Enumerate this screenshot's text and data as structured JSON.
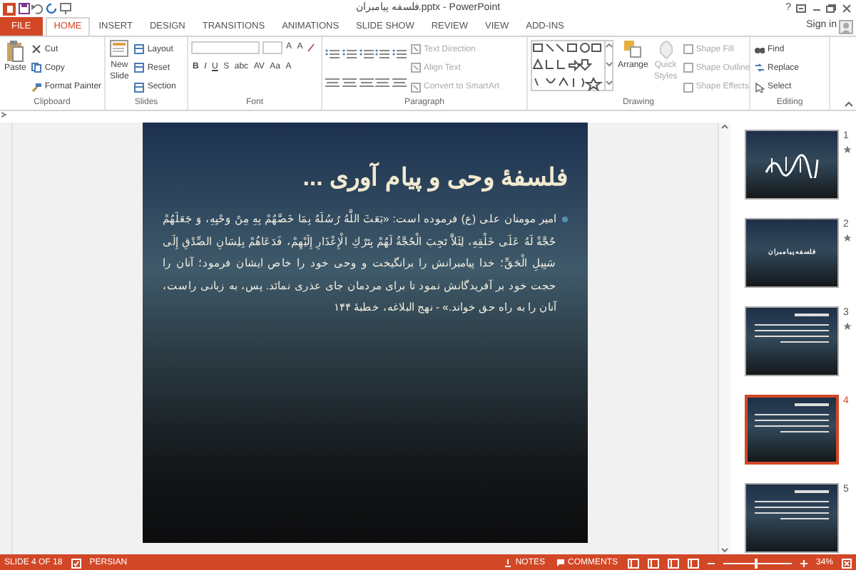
{
  "window": {
    "title": "فلسفه پیامبران.pptx - PowerPoint",
    "sign_in": "Sign in",
    "help": "?"
  },
  "tabs": [
    {
      "label": "FILE",
      "kind": "file",
      "selected": false
    },
    {
      "label": "HOME",
      "kind": "tab",
      "selected": true
    },
    {
      "label": "INSERT",
      "kind": "tab",
      "selected": false
    },
    {
      "label": "DESIGN",
      "kind": "tab",
      "selected": false
    },
    {
      "label": "TRANSITIONS",
      "kind": "tab",
      "selected": false
    },
    {
      "label": "ANIMATIONS",
      "kind": "tab",
      "selected": false
    },
    {
      "label": "SLIDE SHOW",
      "kind": "tab",
      "selected": false
    },
    {
      "label": "REVIEW",
      "kind": "tab",
      "selected": false
    },
    {
      "label": "VIEW",
      "kind": "tab",
      "selected": false
    },
    {
      "label": "ADD-INS",
      "kind": "tab",
      "selected": false
    }
  ],
  "ribbon": {
    "clipboard": {
      "label": "Clipboard",
      "paste": "Paste",
      "items": [
        {
          "label": "Cut",
          "disabled": false
        },
        {
          "label": "Copy",
          "disabled": false
        },
        {
          "label": "Format Painter",
          "disabled": false
        }
      ]
    },
    "slides": {
      "label": "Slides",
      "new_slide": [
        "New",
        "Slide"
      ],
      "items": [
        {
          "label": "Layout",
          "disabled": false
        },
        {
          "label": "Reset",
          "disabled": false
        },
        {
          "label": "Section",
          "disabled": false
        }
      ]
    },
    "font": {
      "label": "Font",
      "grow": [
        "A",
        "A"
      ],
      "format_buttons": [
        "B",
        "I",
        "U",
        "S",
        "abc",
        "AV",
        "Aa",
        "A"
      ]
    },
    "paragraph": {
      "label": "Paragraph",
      "items": [
        {
          "label": "Text Direction",
          "disabled": true
        },
        {
          "label": "Align Text",
          "disabled": true
        },
        {
          "label": "Convert to SmartArt",
          "disabled": true
        }
      ]
    },
    "drawing": {
      "label": "Drawing",
      "arrange": "Arrange",
      "quick_styles": {
        "label": [
          "Quick",
          "Styles"
        ],
        "disabled": true
      },
      "items": [
        {
          "label": "Shape Fill",
          "disabled": true
        },
        {
          "label": "Shape Outline",
          "disabled": true
        },
        {
          "label": "Shape Effects",
          "disabled": true
        }
      ]
    },
    "editing": {
      "label": "Editing",
      "items": [
        {
          "label": "Find",
          "disabled": false
        },
        {
          "label": "Replace",
          "disabled": false
        },
        {
          "label": "Select",
          "disabled": false
        }
      ]
    }
  },
  "slide": {
    "title": "فلسفۀ وحی و پیام آوری ...",
    "body": "امیر مومنان علی (ع) فرموده است: «بَعَثَ اللَّهُ رُسُلَهُ بِمَا خَصَّهُمْ بِهِ مِنْ وَحْيِهِ، وَ جَعَلَهُمْ حُجَّةً لَهُ عَلَى خَلْقِهِ، لِئَلاَّ تَجِبَ الْحُجَّةُ لَهُمْ بِتَرْكِ الْإِعْذَارِ إِلَيْهِمْ، فَدَعَاهُمْ بِلِسَانِ الصِّدْقِ إِلَى سَبِيلِ الْحَقِّ؛ خدا پیامبرانش را برانگیخت و وحی خود را خاص ایشان فرمود؛ آنان را حجت خود بر آفریدگانش نمود تا برای مردمان جای عذری نمانَد. پس، به زبانی راست، آنان را به راه حق خواند.» - نهج البلاغه، خطبۀ ۱۴۴"
  },
  "thumbnails": [
    {
      "number": "1",
      "starred": true,
      "selected": false,
      "kind": "calligraphy"
    },
    {
      "number": "2",
      "starred": true,
      "selected": false,
      "kind": "cover",
      "title": "فلسفه پیامبران"
    },
    {
      "number": "3",
      "starred": true,
      "selected": false,
      "kind": "text"
    },
    {
      "number": "4",
      "starred": false,
      "selected": true,
      "kind": "text"
    },
    {
      "number": "5",
      "starred": false,
      "selected": false,
      "kind": "text"
    }
  ],
  "status_bar": {
    "slide": "SLIDE 4 OF 18",
    "language": "PERSIAN",
    "notes": "NOTES",
    "comments": "COMMENTS",
    "zoom": "34%",
    "zoom_slider": {
      "level": 0.45
    }
  }
}
